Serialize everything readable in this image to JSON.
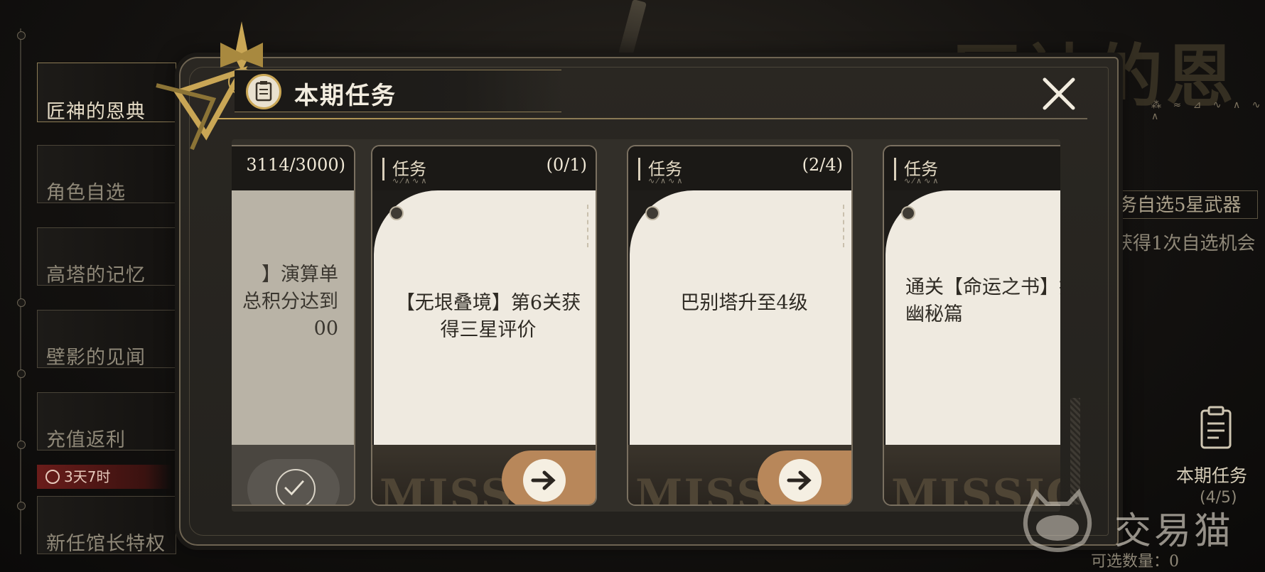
{
  "background": {
    "side_menu": [
      {
        "label": "匠神的恩典",
        "active": true
      },
      {
        "label": "角色自选",
        "active": false
      },
      {
        "label": "高塔的记忆",
        "active": false
      },
      {
        "label": "壁影的见闻",
        "active": false
      },
      {
        "label": "充值返利",
        "active": false
      },
      {
        "label": "新任馆长特权",
        "active": false
      }
    ],
    "timer_badge": "3天7时",
    "event_title": "匠神的恩典",
    "reward_tag": "务自选5星武器",
    "reward_desc": "获得1次自选机会",
    "task_label": "本期任务",
    "task_count": "(4/5)",
    "select_count": "可选数量：0"
  },
  "modal": {
    "title": "本期任务",
    "close_icon": "close-icon",
    "accent_color": "#c9a655",
    "cards": [
      {
        "label": "任务",
        "progress": "3114/3000)",
        "description": "】演算单\n总积分达到\n00",
        "status": "completed"
      },
      {
        "label": "任务",
        "progress": "(0/1)",
        "description": "【无垠叠境】第6关获得三星评价",
        "status": "go"
      },
      {
        "label": "任务",
        "progress": "(2/4)",
        "description": "巴别塔升至4级",
        "status": "go"
      },
      {
        "label": "任务",
        "progress": "",
        "description": "通关【命运之书】探索模式幽秘篇",
        "status": "go"
      }
    ],
    "watermark_word": "MISSION"
  },
  "watermark": {
    "text": "交易猫"
  }
}
